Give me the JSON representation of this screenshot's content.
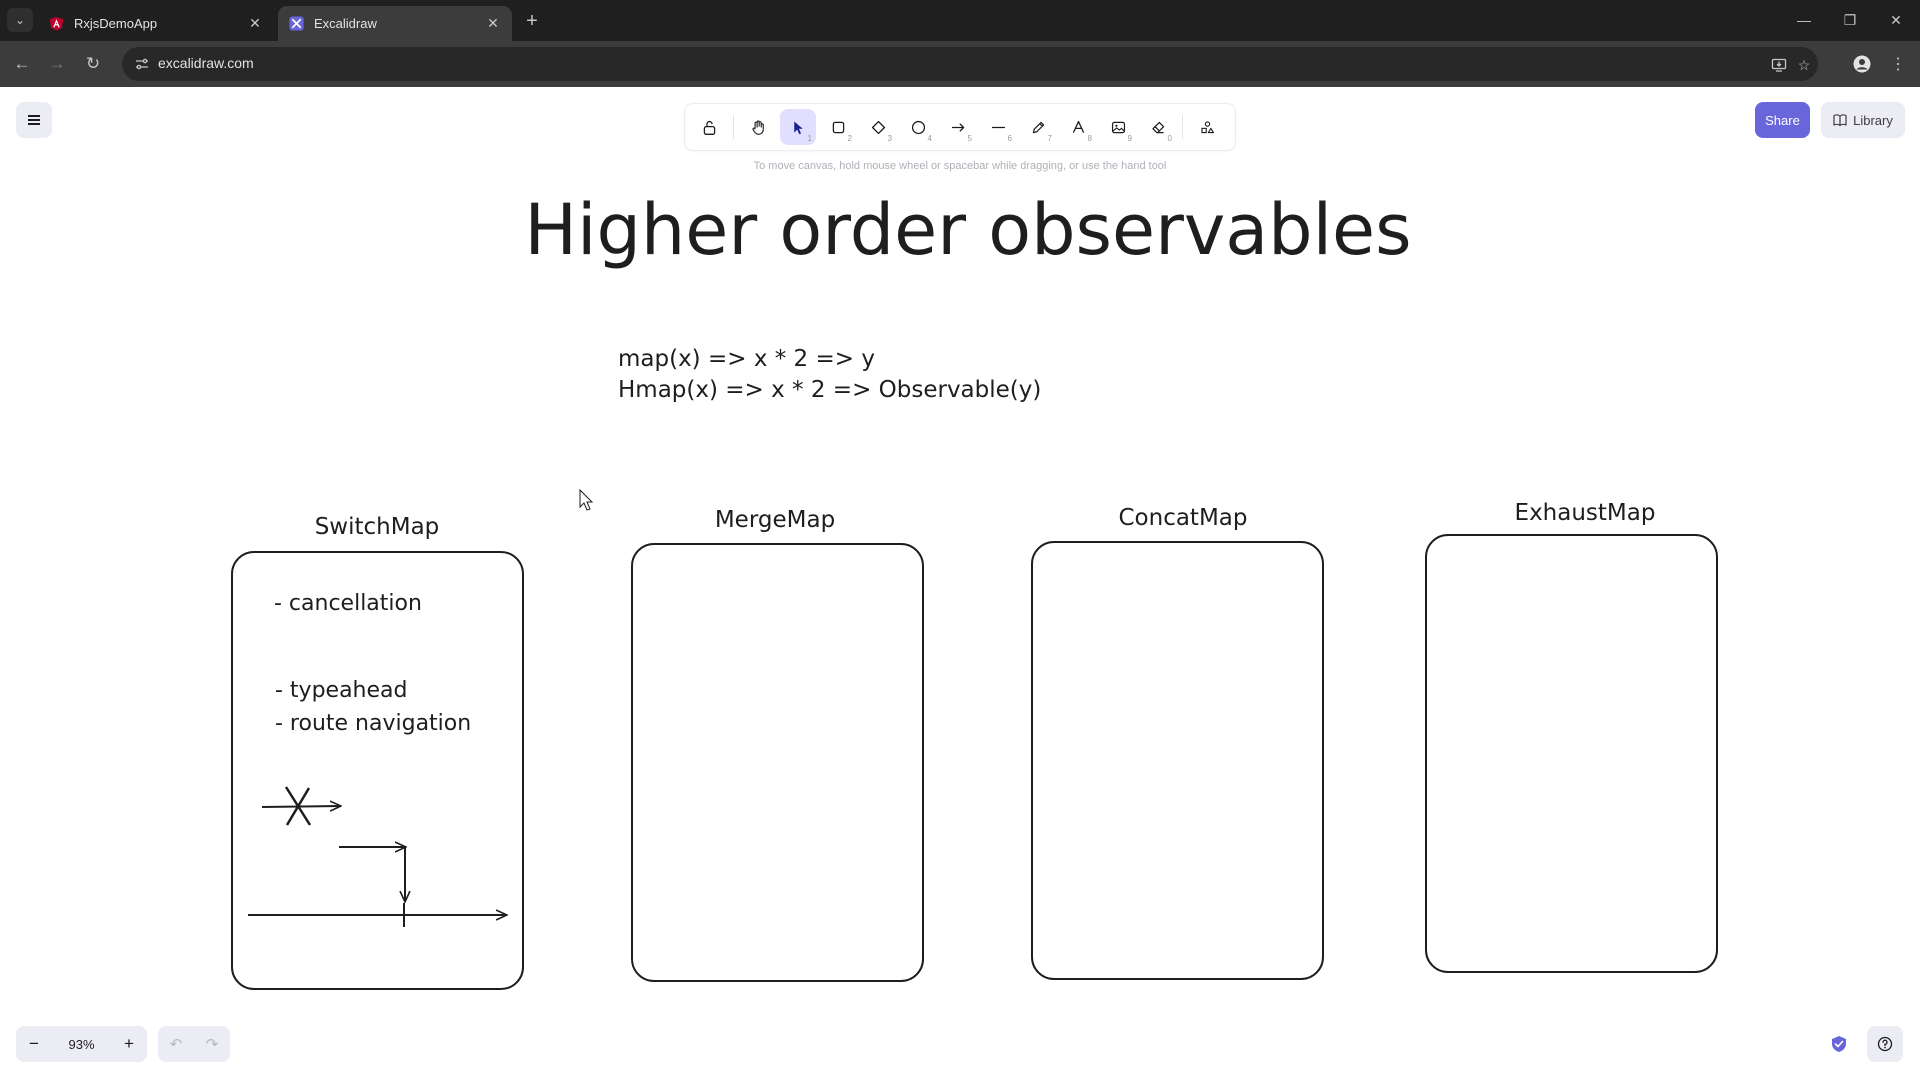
{
  "browser": {
    "tabs": [
      {
        "title": "RxjsDemoApp",
        "active": false,
        "favicon": "angular-icon"
      },
      {
        "title": "Excalidraw",
        "active": true,
        "favicon": "excalidraw-icon"
      }
    ],
    "url": "excalidraw.com"
  },
  "toolbar": {
    "tools": [
      {
        "name": "lock",
        "key": ""
      },
      {
        "name": "hand",
        "key": ""
      },
      {
        "name": "selection",
        "key": "1",
        "active": true
      },
      {
        "name": "rectangle",
        "key": "2"
      },
      {
        "name": "diamond",
        "key": "3"
      },
      {
        "name": "ellipse",
        "key": "4"
      },
      {
        "name": "arrow",
        "key": "5"
      },
      {
        "name": "line",
        "key": "6"
      },
      {
        "name": "draw",
        "key": "7"
      },
      {
        "name": "text",
        "key": "8"
      },
      {
        "name": "image",
        "key": "9"
      },
      {
        "name": "eraser",
        "key": "0"
      },
      {
        "name": "extra-tools",
        "key": ""
      }
    ],
    "hint": "To move canvas, hold mouse wheel or spacebar while dragging, or use the hand tool"
  },
  "actions": {
    "share_label": "Share",
    "library_label": "Library"
  },
  "footer": {
    "zoom": "93%"
  },
  "drawing": {
    "title": "Higher order observables",
    "formula_1": "map(x) => x * 2 => y",
    "formula_2": "Hmap(x) => x * 2 => Observable(y)",
    "boxes": [
      {
        "label": "SwitchMap",
        "notes": [
          "- cancellation",
          "- typeahead",
          "- route navigation"
        ]
      },
      {
        "label": "MergeMap",
        "notes": []
      },
      {
        "label": "ConcatMap",
        "notes": []
      },
      {
        "label": "ExhaustMap",
        "notes": []
      }
    ]
  },
  "colors": {
    "accent": "#6965db",
    "stroke": "#1e1e1e",
    "active_tool_bg": "#e0dfff"
  }
}
